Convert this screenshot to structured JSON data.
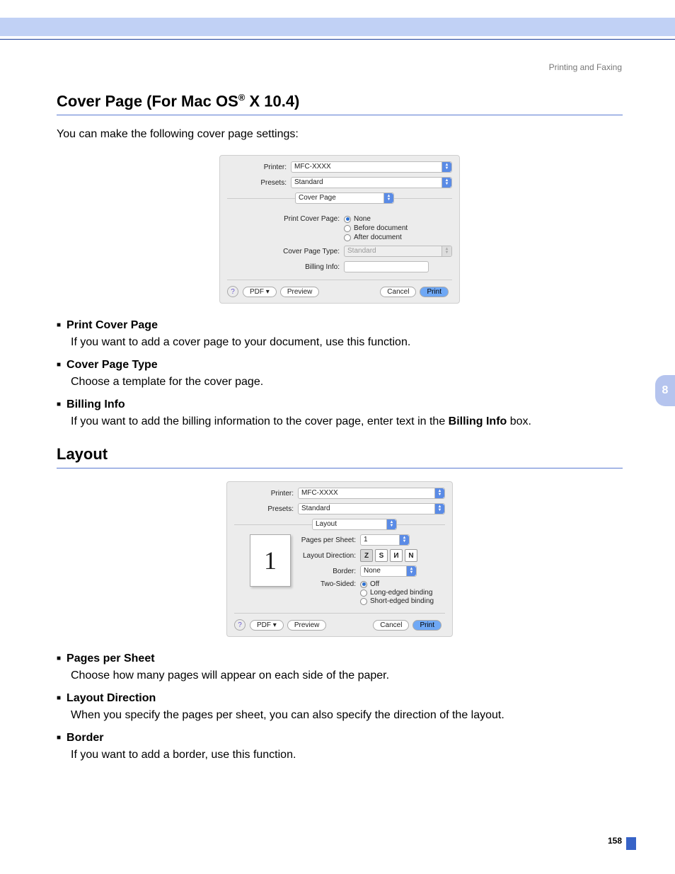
{
  "breadcrumb": "Printing and Faxing",
  "heading1_pre": "Cover Page (For Mac OS",
  "heading1_sup": "®",
  "heading1_post": " X 10.4)",
  "intro": "You can make the following cover page settings:",
  "dialog1": {
    "printer_label": "Printer:",
    "printer_value": "MFC-XXXX",
    "presets_label": "Presets:",
    "presets_value": "Standard",
    "panel_value": "Cover Page",
    "print_cover_label": "Print Cover Page:",
    "opt_none": "None",
    "opt_before": "Before document",
    "opt_after": "After document",
    "type_label": "Cover Page Type:",
    "type_value": "Standard",
    "billing_label": "Billing Info:",
    "help": "?",
    "pdf": "PDF ▾",
    "preview": "Preview",
    "cancel": "Cancel",
    "print": "Print"
  },
  "list1": {
    "i1t": "Print Cover Page",
    "i1b": "If you want to add a cover page to your document, use this function.",
    "i2t": "Cover Page Type",
    "i2b": "Choose a template for the cover page.",
    "i3t": "Billing Info",
    "i3b_pre": "If you want to add the billing information to the cover page, enter text in the ",
    "i3b_bold": "Billing Info",
    "i3b_post": " box."
  },
  "heading2": "Layout",
  "dialog2": {
    "printer_label": "Printer:",
    "printer_value": "MFC-XXXX",
    "presets_label": "Presets:",
    "presets_value": "Standard",
    "panel_value": "Layout",
    "preview_num": "1",
    "pps_label": "Pages per Sheet:",
    "pps_value": "1",
    "dir_label": "Layout Direction:",
    "d1": "Z",
    "d2": "S",
    "d3": "И",
    "d4": "N",
    "border_label": "Border:",
    "border_value": "None",
    "ts_label": "Two-Sided:",
    "ts1": "Off",
    "ts2": "Long-edged binding",
    "ts3": "Short-edged binding",
    "help": "?",
    "pdf": "PDF ▾",
    "preview": "Preview",
    "cancel": "Cancel",
    "print": "Print"
  },
  "list2": {
    "i1t": "Pages per Sheet",
    "i1b": "Choose how many pages will appear on each side of the paper.",
    "i2t": "Layout Direction",
    "i2b": "When you specify the pages per sheet, you can also specify the direction of the layout.",
    "i3t": "Border",
    "i3b": "If you want to add a border, use this function."
  },
  "section_tab": "8",
  "page_number": "158"
}
